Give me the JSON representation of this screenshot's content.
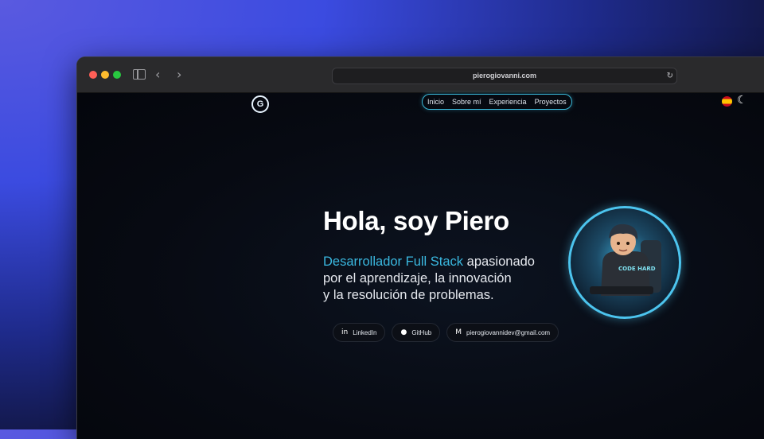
{
  "browser": {
    "url": "pierogiovanni.com"
  },
  "site": {
    "logo_letter": "G",
    "nav": [
      "Inicio",
      "Sobre mí",
      "Experiencia",
      "Proyectos"
    ],
    "hero_title": "Hola, soy Piero",
    "hero_accent": "Desarrollador Full Stack",
    "hero_line1_rest": " apasionado",
    "hero_line2": "por el aprendizaje, la innovación",
    "hero_line3": "y la resolución de problemas.",
    "links": {
      "linkedin": "LinkedIn",
      "github": "GitHub",
      "email": "pierogiovannidev@gmail.com"
    },
    "avatar_shirt_text": "CODE HARD"
  },
  "icons": {
    "linkedin": "in",
    "github": "●",
    "email": "M",
    "moon": "☾",
    "back": "‹",
    "forward": "›",
    "reload": "↻"
  },
  "colors": {
    "accent": "#3ab8e0",
    "avatar_ring": "#4cc4ee"
  }
}
